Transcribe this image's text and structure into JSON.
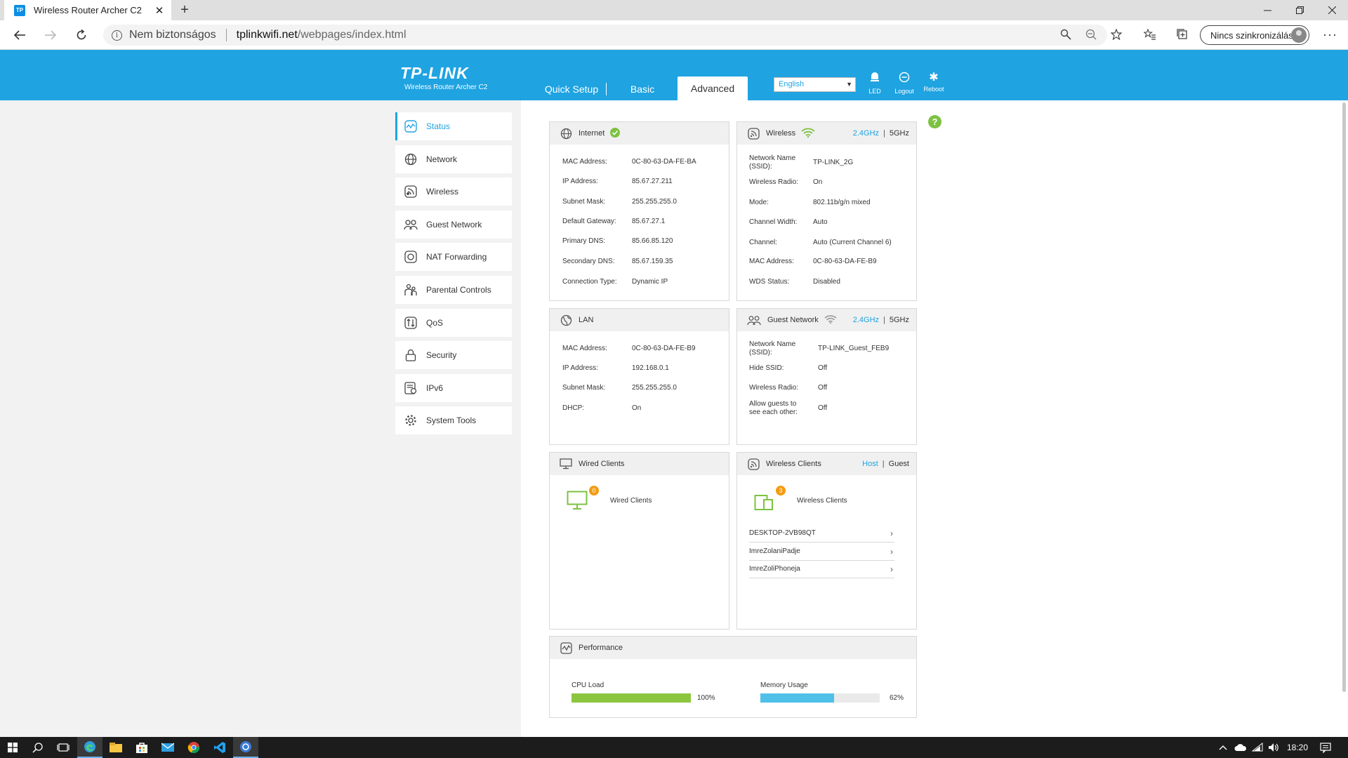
{
  "browser": {
    "tab_title": "Wireless Router Archer C2",
    "tab_favicon": "TP",
    "close_tab": "✕",
    "new_tab": "+",
    "insecure_label": "Nem biztonságos",
    "url_host": "tplinkwifi.net",
    "url_path": "/webpages/index.html",
    "sync_label": "Nincs szinkronizálás",
    "menu": "···"
  },
  "header": {
    "logo": "TP-LINK",
    "model": "Wireless Router Archer C2",
    "tabs": [
      "Quick Setup",
      "Basic",
      "Advanced"
    ],
    "active_tab": "Advanced",
    "language": "English",
    "icons": [
      {
        "name": "led-icon",
        "label": "LED"
      },
      {
        "name": "logout-icon",
        "label": "Logout"
      },
      {
        "name": "reboot-icon",
        "label": "Reboot"
      }
    ]
  },
  "sidebar": {
    "items": [
      {
        "label": "Status",
        "icon": "status-icon"
      },
      {
        "label": "Network",
        "icon": "globe-icon"
      },
      {
        "label": "Wireless",
        "icon": "wireless-icon"
      },
      {
        "label": "Guest Network",
        "icon": "guest-icon"
      },
      {
        "label": "NAT Forwarding",
        "icon": "nat-icon"
      },
      {
        "label": "Parental Controls",
        "icon": "parental-icon"
      },
      {
        "label": "QoS",
        "icon": "qos-icon"
      },
      {
        "label": "Security",
        "icon": "lock-icon"
      },
      {
        "label": "IPv6",
        "icon": "ipv6-icon"
      },
      {
        "label": "System Tools",
        "icon": "gear-icon"
      }
    ],
    "active": "Status"
  },
  "internet": {
    "title": "Internet",
    "rows": [
      {
        "label": "MAC Address:",
        "value": "0C-80-63-DA-FE-BA"
      },
      {
        "label": "IP Address:",
        "value": "85.67.27.211"
      },
      {
        "label": "Subnet Mask:",
        "value": "255.255.255.0"
      },
      {
        "label": "Default Gateway:",
        "value": "85.67.27.1"
      },
      {
        "label": "Primary DNS:",
        "value": "85.66.85.120"
      },
      {
        "label": "Secondary DNS:",
        "value": "85.67.159.35"
      },
      {
        "label": "Connection Type:",
        "value": "Dynamic IP"
      }
    ]
  },
  "wireless": {
    "title": "Wireless",
    "band_24": "2.4GHz",
    "band_5": "5GHz",
    "divider": "|",
    "rows": [
      {
        "label": "Network Name (SSID):",
        "value": "TP-LINK_2G"
      },
      {
        "label": "Wireless Radio:",
        "value": "On"
      },
      {
        "label": "Mode:",
        "value": "802.11b/g/n mixed"
      },
      {
        "label": "Channel Width:",
        "value": "Auto"
      },
      {
        "label": "Channel:",
        "value": "Auto (Current Channel 6)"
      },
      {
        "label": "MAC Address:",
        "value": "0C-80-63-DA-FE-B9"
      },
      {
        "label": "WDS Status:",
        "value": "Disabled"
      }
    ]
  },
  "lan": {
    "title": "LAN",
    "rows": [
      {
        "label": "MAC Address:",
        "value": "0C-80-63-DA-FE-B9"
      },
      {
        "label": "IP Address:",
        "value": "192.168.0.1"
      },
      {
        "label": "Subnet Mask:",
        "value": "255.255.255.0"
      },
      {
        "label": "DHCP:",
        "value": "On"
      }
    ]
  },
  "guest": {
    "title": "Guest Network",
    "band_24": "2.4GHz",
    "band_5": "5GHz",
    "divider": "|",
    "rows": [
      {
        "label": "Network Name (SSID):",
        "value": "TP-LINK_Guest_FEB9"
      },
      {
        "label": "Hide SSID:",
        "value": "Off"
      },
      {
        "label": "Wireless Radio:",
        "value": "Off"
      },
      {
        "label": "Allow guests to see each other:",
        "value": "Off"
      }
    ]
  },
  "wired_clients": {
    "title": "Wired Clients",
    "label": "Wired Clients",
    "count": "0"
  },
  "wireless_clients": {
    "title": "Wireless Clients",
    "host": "Host",
    "guest": "Guest",
    "divider": "|",
    "label": "Wireless Clients",
    "count": "3",
    "clients": [
      "DESKTOP-2VB98QT",
      "ImreZolaniPadje",
      "ImreZoliPhoneja"
    ],
    "chevron": "›"
  },
  "performance": {
    "title": "Performance",
    "cpu_label": "CPU Load",
    "cpu_value": 100,
    "cpu_text": "100%",
    "mem_label": "Memory Usage",
    "mem_value": 62,
    "mem_text": "62%"
  },
  "help": "?",
  "taskbar": {
    "time": "18:20"
  },
  "colors": {
    "accent": "#1fa3e1",
    "cpu_bar": "#8cc63e",
    "mem_bar": "#4fc0e8",
    "badge": "#f39c12",
    "ok": "#7dc242"
  }
}
